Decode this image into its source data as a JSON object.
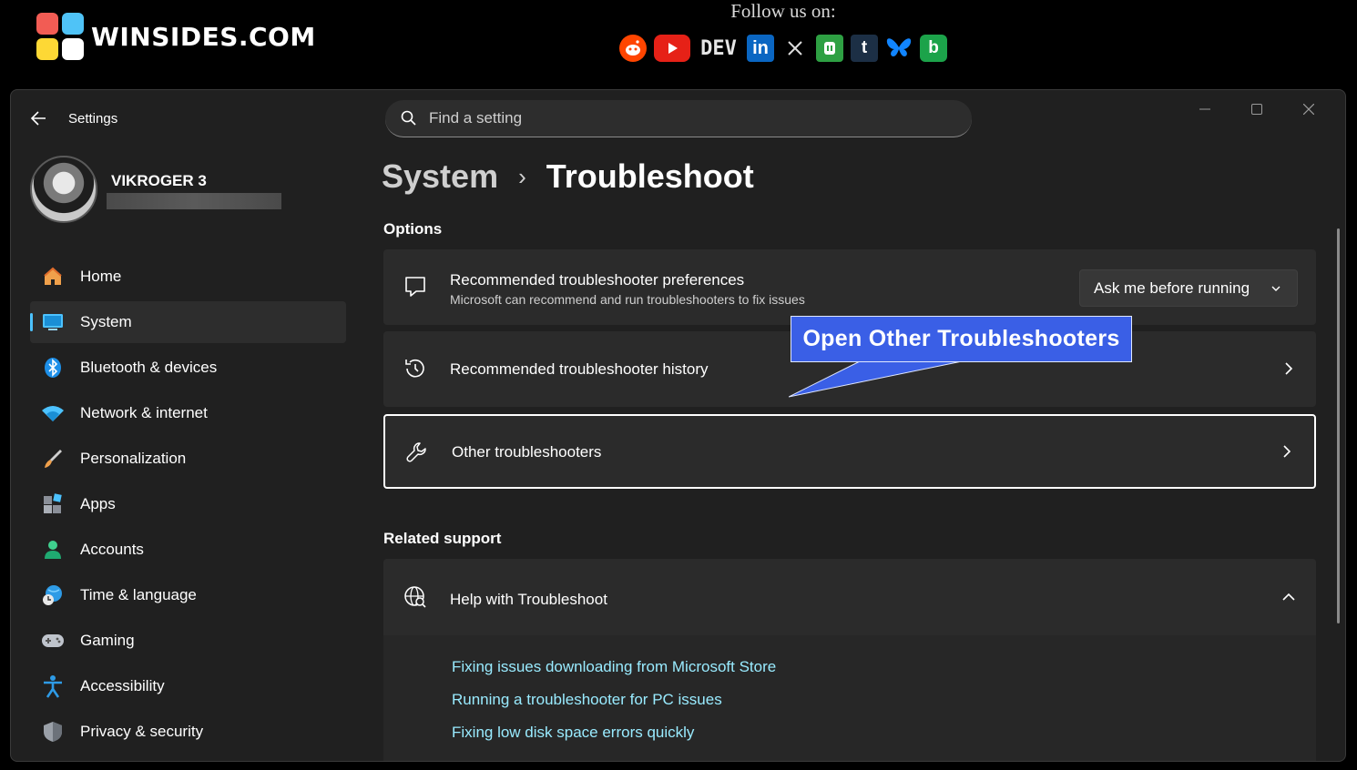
{
  "banner": {
    "site_name": "WINSIDES.COM",
    "follow_text": "Follow us on:",
    "logo_colors": [
      "#f25c54",
      "#4fc3f7",
      "#fdd835",
      "#ffffff"
    ],
    "social_icons": [
      "reddit-icon",
      "youtube-icon",
      "dev-icon",
      "linkedin-icon",
      "x-icon",
      "mastodon-icon",
      "tumblr-icon",
      "bluesky-icon",
      "bing-icon"
    ],
    "dev_label": "DEV",
    "tumblr_label": "t",
    "bing_label": "b"
  },
  "window": {
    "title": "Settings",
    "search_placeholder": "Find a setting"
  },
  "profile": {
    "name": "VIKROGER 3"
  },
  "sidebar": {
    "items": [
      {
        "label": "Home",
        "icon": "home-icon"
      },
      {
        "label": "System",
        "icon": "system-icon",
        "active": true
      },
      {
        "label": "Bluetooth & devices",
        "icon": "bluetooth-icon"
      },
      {
        "label": "Network & internet",
        "icon": "wifi-icon"
      },
      {
        "label": "Personalization",
        "icon": "brush-icon"
      },
      {
        "label": "Apps",
        "icon": "apps-icon"
      },
      {
        "label": "Accounts",
        "icon": "person-icon"
      },
      {
        "label": "Time & language",
        "icon": "globe-clock-icon"
      },
      {
        "label": "Gaming",
        "icon": "gamepad-icon"
      },
      {
        "label": "Accessibility",
        "icon": "accessibility-icon"
      },
      {
        "label": "Privacy & security",
        "icon": "shield-icon"
      }
    ]
  },
  "breadcrumb": {
    "parent": "System",
    "separator": "›",
    "current": "Troubleshoot"
  },
  "options": {
    "section_title": "Options",
    "preferences": {
      "title": "Recommended troubleshooter preferences",
      "subtitle": "Microsoft can recommend and run troubleshooters to fix issues",
      "dropdown_value": "Ask me before running"
    },
    "history": {
      "title": "Recommended troubleshooter history"
    },
    "other": {
      "title": "Other troubleshooters"
    }
  },
  "related": {
    "section_title": "Related support",
    "expander_title": "Help with Troubleshoot",
    "links": [
      "Fixing issues downloading from Microsoft Store",
      "Running a troubleshooter for PC issues",
      "Fixing low disk space errors quickly"
    ]
  },
  "callout": {
    "text": "Open Other Troubleshooters",
    "color": "#3a5fe6"
  },
  "colors": {
    "accent": "#4cc2ff",
    "link": "#99ebff",
    "window_bg": "#202020",
    "card_bg": "#2b2b2b"
  }
}
